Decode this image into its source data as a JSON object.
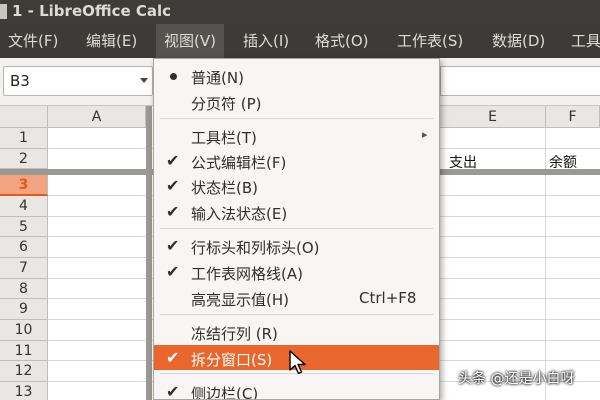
{
  "window": {
    "title": "1 - LibreOffice Calc"
  },
  "menubar": [
    "文件(F)",
    "编辑(E)",
    "视图(V)",
    "插入(I)",
    "格式(O)",
    "工作表(S)",
    "数据(D)",
    "工具"
  ],
  "namebox": {
    "value": "B3"
  },
  "columns": [
    "A",
    "E",
    "F"
  ],
  "rows": [
    "1",
    "2",
    "3",
    "4",
    "5",
    "6",
    "7",
    "8",
    "9",
    "10",
    "11",
    "12",
    "13"
  ],
  "selected_row": "3",
  "cells": {
    "E2": "支出",
    "F2": "余额"
  },
  "view_menu": {
    "items": [
      {
        "label": "普通(N)",
        "mark": "dot"
      },
      {
        "label": "分页符 (P)",
        "mark": ""
      },
      {
        "label": "工具栏(T)",
        "mark": "",
        "submenu": true
      },
      {
        "label": "公式编辑栏(F)",
        "mark": "check"
      },
      {
        "label": "状态栏(B)",
        "mark": "check"
      },
      {
        "label": "输入法状态(E)",
        "mark": "check"
      },
      {
        "label": "行标头和列标头(O)",
        "mark": "check"
      },
      {
        "label": "工作表网格线(A)",
        "mark": "check"
      },
      {
        "label": "高亮显示值(H)",
        "mark": "",
        "shortcut": "Ctrl+F8"
      },
      {
        "label": "冻结行列 (R)",
        "mark": ""
      },
      {
        "label": "拆分窗口(S)",
        "mark": "check",
        "highlighted": true
      },
      {
        "label": "侧边栏(C)",
        "mark": "check"
      }
    ]
  },
  "icons": {
    "check": "check-icon",
    "bullet": "radio-dot-icon",
    "submenu": "submenu-arrow-icon",
    "pointer": "mouse-pointer-icon"
  },
  "colors": {
    "highlight": "#e9662c",
    "titlebar": "#3d3c38",
    "selected_row": "#f4a380"
  },
  "watermark": "头条 @还是小白呀"
}
